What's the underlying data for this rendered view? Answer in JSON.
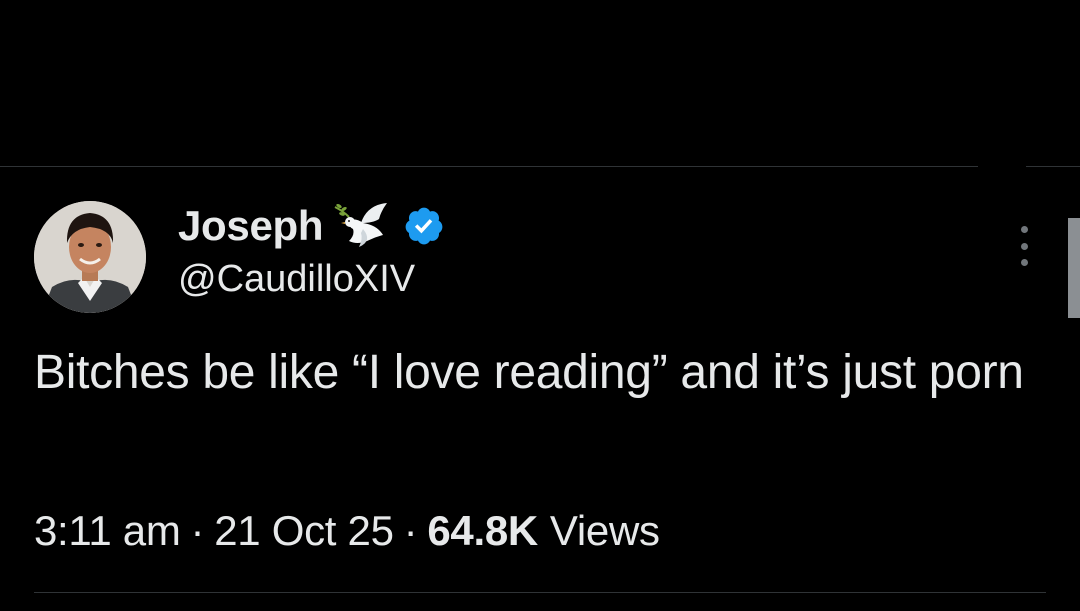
{
  "author": {
    "display_name": "Joseph",
    "handle": "@CaudilloXIV",
    "badge_icon": "dove-icon",
    "verified_icon": "verified-badge-icon",
    "verified_color": "#1d9bf0"
  },
  "tweet": {
    "text": "Bitches be like “I love reading” and it’s just porn"
  },
  "meta": {
    "time": "3:11 am",
    "date": "21 Oct 25",
    "separator": "·",
    "views_count": "64.8K",
    "views_label": "Views"
  },
  "colors": {
    "background": "#000000",
    "text": "#e7e9ea",
    "divider": "#2f3336",
    "muted": "#71767b"
  }
}
